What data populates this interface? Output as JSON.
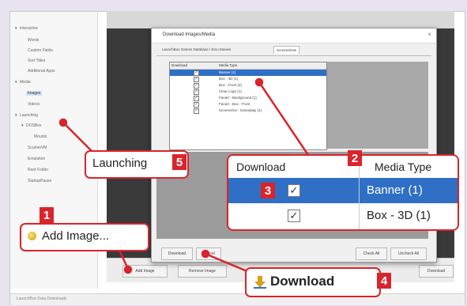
{
  "tree": {
    "items": [
      {
        "label": "Interactive",
        "arrow": "▾"
      },
      {
        "label": "Words",
        "arrow": ""
      },
      {
        "label": "Custom Fields",
        "arrow": ""
      },
      {
        "label": "Sort Titles",
        "arrow": ""
      },
      {
        "label": "Additional Apps",
        "arrow": ""
      },
      {
        "label": "Media",
        "arrow": "▾"
      },
      {
        "label": "Images",
        "arrow": ""
      },
      {
        "label": "Videos",
        "arrow": ""
      },
      {
        "label": "Launching",
        "arrow": "▾"
      },
      {
        "label": "DOSBox",
        "arrow": "▾"
      },
      {
        "label": "Mounts",
        "arrow": ""
      },
      {
        "label": "ScummVM",
        "arrow": ""
      },
      {
        "label": "Emulation",
        "arrow": ""
      },
      {
        "label": "Root Folder",
        "arrow": ""
      },
      {
        "label": "StartupPause",
        "arrow": ""
      }
    ]
  },
  "status": {
    "text": "LaunchBox Data Downloads"
  },
  "main": {
    "add_image_small": "Add Image",
    "remove_image": "Remove Image",
    "download_small": "Download"
  },
  "dialog": {
    "title": "Download Images/Media",
    "tabs": [
      "LaunchBox Games Database / Emu Movies",
      "Screenshots"
    ],
    "columns": [
      "Download",
      "Media Type"
    ],
    "rows": [
      {
        "checked": "✓",
        "type": "Banner (1)"
      },
      {
        "checked": "✓",
        "type": "Box - 3D (1)"
      },
      {
        "checked": "✓",
        "type": "Box - Front (2)"
      },
      {
        "checked": "✓",
        "type": "Clear Logo (1)"
      },
      {
        "checked": "✓",
        "type": "Fanart - Background (1)"
      },
      {
        "checked": "✓",
        "type": "Fanart - Box - Front"
      },
      {
        "checked": "✓",
        "type": "Screenshot - Gameplay (4)"
      }
    ],
    "download_btn": "Download",
    "cancel_btn": "Cancel",
    "check_all": "Check All",
    "uncheck_all": "Uncheck All"
  },
  "callouts": {
    "launching": {
      "text": "Launching",
      "number": "5"
    },
    "add_image": {
      "text": "Add Image...",
      "number": "1"
    },
    "download": {
      "text": "Download",
      "number": "4"
    },
    "zoom_number": "2",
    "checkbox_number": "3"
  },
  "zoom": {
    "columns": [
      "Download",
      "Media Type"
    ],
    "rows": [
      {
        "checked": "✓",
        "type": "Banner (1)"
      },
      {
        "checked": "✓",
        "type": "Box - 3D (1)"
      }
    ]
  },
  "colors": {
    "accent": "#d9242c",
    "selection": "#2f6fc5"
  }
}
